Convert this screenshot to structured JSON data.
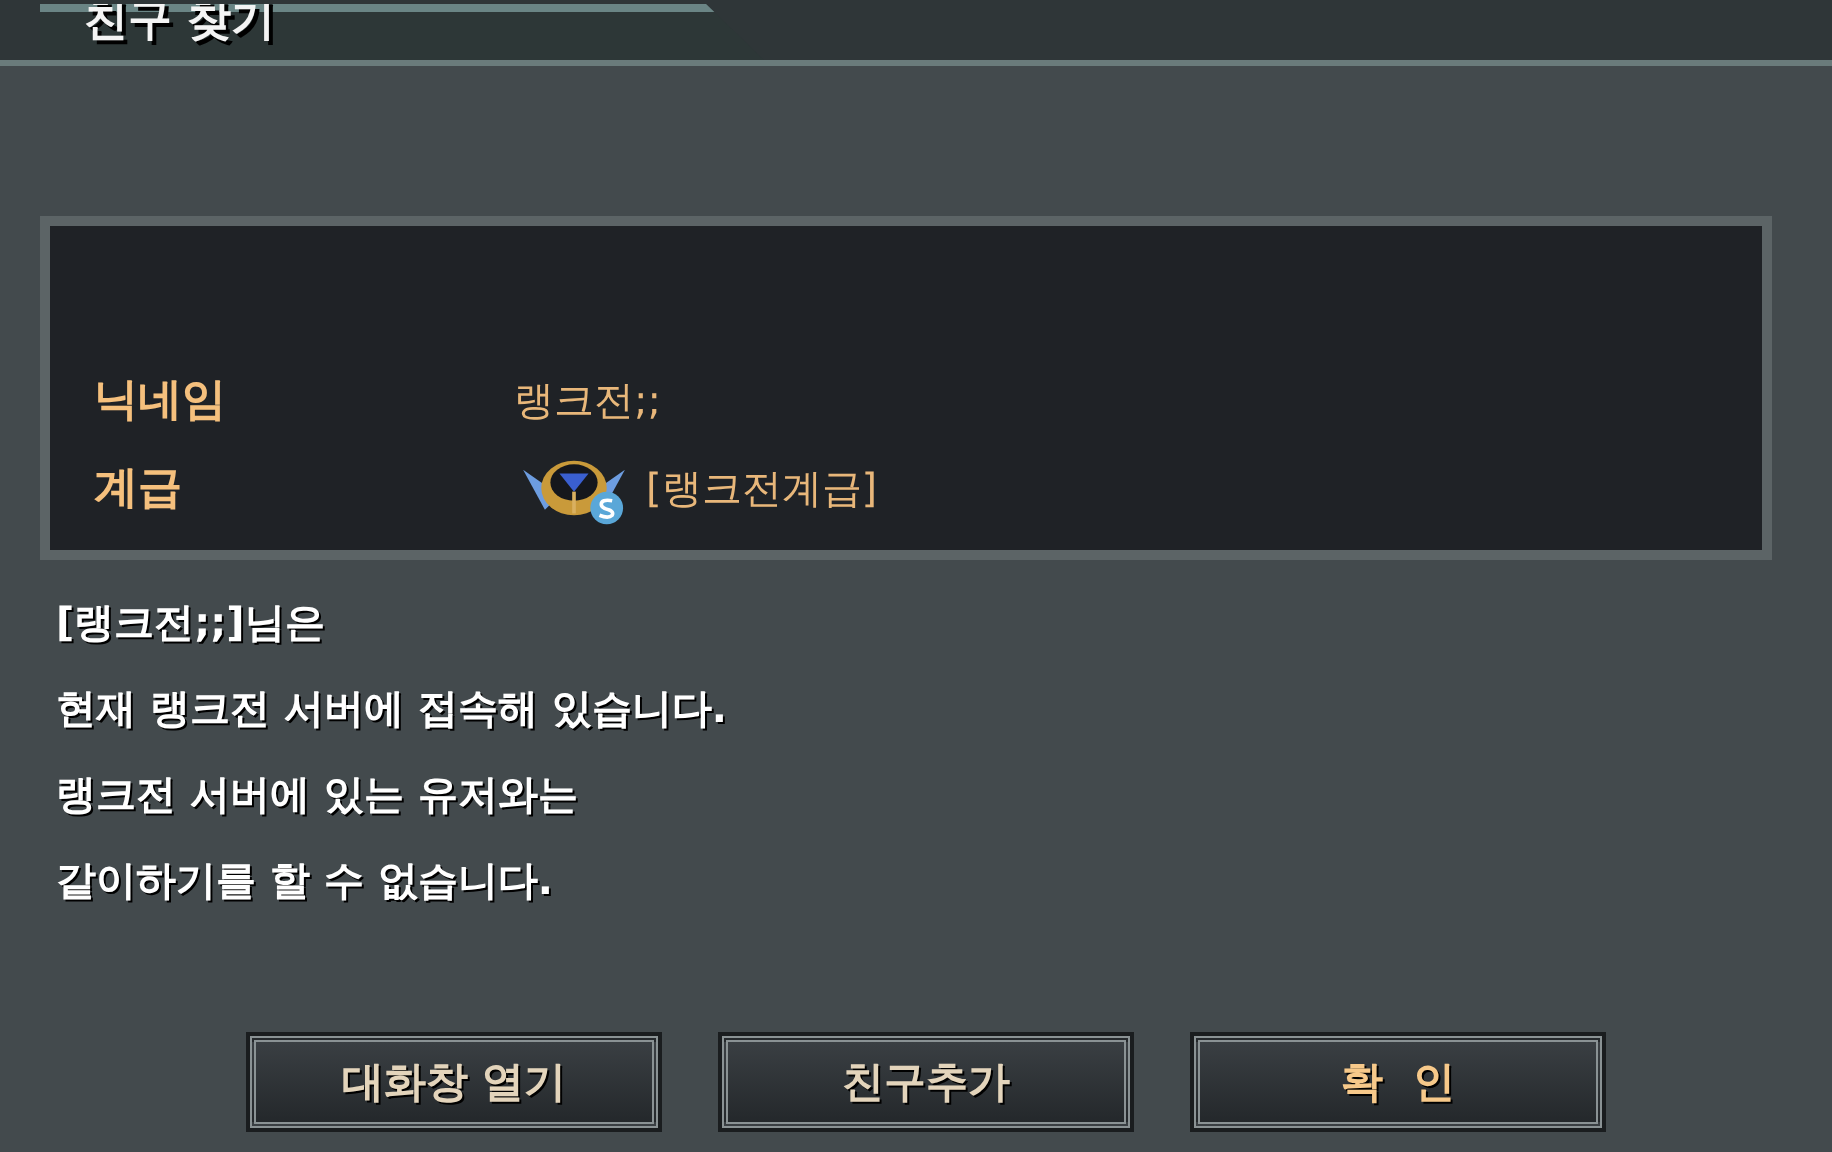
{
  "window": {
    "title": "친구 찾기"
  },
  "info": [
    {
      "label": "닉네임",
      "value": "랭크전;;",
      "kind": "text"
    },
    {
      "label": "계급",
      "value": "[랭크전계급]",
      "kind": "rank"
    }
  ],
  "message": [
    "[랭크전;;]님은",
    "현재 랭크전 서버에 접속해 있습니다.",
    "랭크전 서버에 있는 유저와는",
    "같이하기를 할 수 없습니다."
  ],
  "buttons": [
    {
      "label": "대화창 열기",
      "highlighted": false
    },
    {
      "label": "친구추가",
      "highlighted": false
    },
    {
      "label": "확  인",
      "highlighted": true
    }
  ]
}
